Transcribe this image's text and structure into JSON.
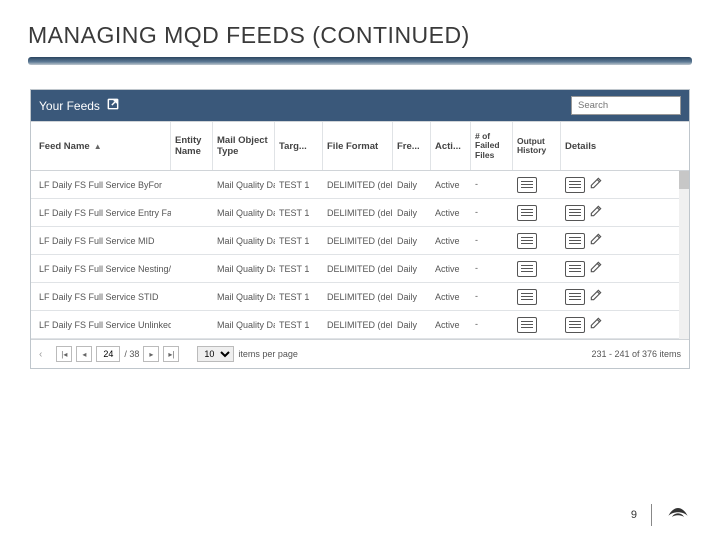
{
  "slide": {
    "title": "MANAGING MQD FEEDS (CONTINUED)"
  },
  "panel": {
    "title": "Your Feeds",
    "search_placeholder": "Search"
  },
  "columns": {
    "feed": "Feed Name",
    "entity": "Entity Name",
    "mobj": "Mail Object Type",
    "targ": "Targ...",
    "format": "File Format",
    "freq": "Fre...",
    "acti": "Acti...",
    "failed": "# of Failed Files",
    "output": "Output History",
    "details": "Details"
  },
  "rows": [
    {
      "feed": "LF Daily FS Full Service ByFor",
      "entity": "",
      "mobj": "Mail Quality Data",
      "targ": "TEST 1",
      "format": "DELIMITED (del...",
      "freq": "Daily",
      "acti": "Active",
      "failed": "-"
    },
    {
      "feed": "LF Daily FS Full Service Entry Facility",
      "entity": "",
      "mobj": "Mail Quality Data",
      "targ": "TEST 1",
      "format": "DELIMITED (deli...",
      "freq": "Daily",
      "acti": "Active",
      "failed": "-"
    },
    {
      "feed": "LF Daily FS Full Service MID",
      "entity": "",
      "mobj": "Mail Quality Data",
      "targ": "TEST 1",
      "format": "DELIMITED (del...",
      "freq": "Daily",
      "acti": "Active",
      "failed": "-"
    },
    {
      "feed": "LF Daily FS Full Service Nesting/Sort...",
      "entity": "",
      "mobj": "Mail Quality Data",
      "targ": "TEST 1",
      "format": "DELIMITED (del...",
      "freq": "Daily",
      "acti": "Active",
      "failed": "-"
    },
    {
      "feed": "LF Daily FS Full Service STID",
      "entity": "",
      "mobj": "Mail Quality Data",
      "targ": "TEST 1",
      "format": "DELIMITED (del...",
      "freq": "Daily",
      "acti": "Active",
      "failed": "-"
    },
    {
      "feed": "LF Daily FS Full Service Unlinked Copal",
      "entity": "",
      "mobj": "Mail Quality Data",
      "targ": "TEST 1",
      "format": "DELIMITED (del...",
      "freq": "Daily",
      "acti": "Active",
      "failed": "-"
    }
  ],
  "pager": {
    "current": "24",
    "total_pages": "/ 38",
    "per_page": "10",
    "per_page_label": "items per page",
    "range": "231 - 241 of 376 items"
  },
  "footer": {
    "page_number": "9"
  }
}
